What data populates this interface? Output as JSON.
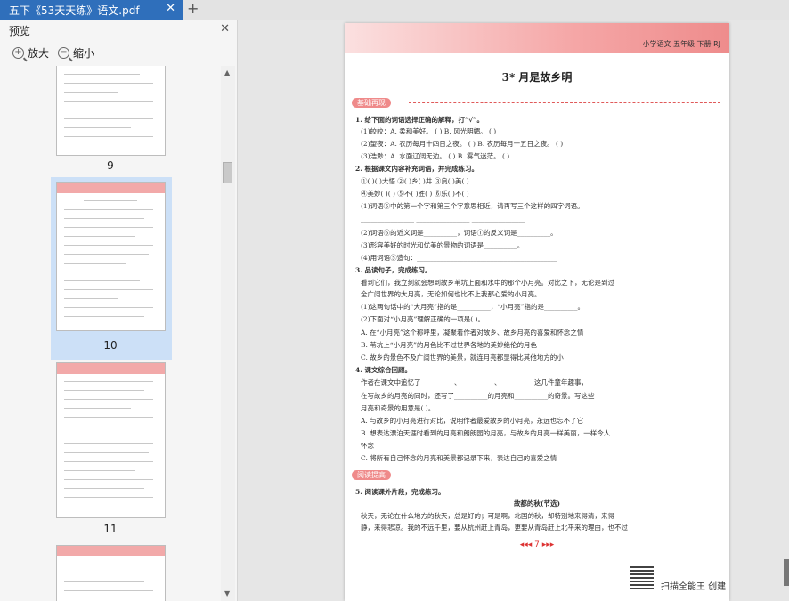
{
  "tab": {
    "title": "五下《53天天练》语文.pdf",
    "close": "✕",
    "add": "+"
  },
  "panel": {
    "title": "预览",
    "close": "✕",
    "zoom_in": "放大",
    "zoom_out": "缩小"
  },
  "thumbnails": [
    {
      "label": "9"
    },
    {
      "label": "10",
      "selected": true
    },
    {
      "label": "11"
    },
    {
      "label": ""
    }
  ],
  "page": {
    "header": "小学语文  五年级  下册  RJ",
    "title": "3*  月是故乡明",
    "section1": "基础再现",
    "section2": "阅读提高",
    "lines": [
      {
        "text": "1. 给下面的词语选择正确的解释，打“√”。",
        "bold": true
      },
      {
        "text": "(1)皎皎：A. 柔和美好。    (    )        B. 风光明媚。    (    )"
      },
      {
        "text": "(2)望夜：A. 农历每月十四日之夜。 (    )     B. 农历每月十五日之夜。 (    )"
      },
      {
        "text": "(3)浩渺：A. 水面辽阔无边。    (    )        B. 雾气迷茫。    (    )"
      },
      {
        "text": "2. 根据课文内容补充词语，并完成练习。",
        "bold": true
      },
      {
        "text": "①(    )(    )大悟      ②(    )乡(    )井      ③良(    )美(    )"
      },
      {
        "text": "④美妙(    )(    )      ⑤不(    )胜(    )      ⑥乐(    )不(    )"
      },
      {
        "text": "(1)词语⑤中的第一个字和第三个字意思相近，请再写三个这样的四字词语。"
      },
      {
        "text": "________________  ________________  ________________"
      },
      {
        "text": "(2)词语⑥的近义词是__________，词语①的反义词是__________。"
      },
      {
        "text": "(3)形容美好的时光和优美的景物的词语是__________。"
      },
      {
        "text": "(4)用词语⑤造句：__________________________________________"
      },
      {
        "text": "3. 品读句子，完成练习。",
        "bold": true
      },
      {
        "text": "    看到它们，我立刻就会想到故乡苇坑上面和水中的那个小月亮。对比之下，无论是到过"
      },
      {
        "text": "全广阔世界的大月亮，无论如何也比不上我那心爱的小月亮。"
      },
      {
        "text": "(1)这两句话中的“大月亮”指的是__________，“小月亮”指的是__________。"
      },
      {
        "text": "(2)下面对“小月亮”理解正确的一项是(    )。"
      },
      {
        "text": "    A. 在“小月亮”这个称呼里，凝聚着作者对故乡、故乡月亮的喜爱和怀念之情"
      },
      {
        "text": "    B. 苇坑上“小月亮”的月色比不过世界各地的美妙绝伦的月色"
      },
      {
        "text": "    C. 故乡的景色不及广阔世界的美景，就连月亮都显得比其他地方的小"
      },
      {
        "text": "4. 课文综合回顾。",
        "bold": true
      },
      {
        "text": "    作者在课文中追忆了__________、__________、__________这几件童年趣事，"
      },
      {
        "text": "在写故乡的月亮的同时，还写了__________的月亮和__________的奇景。写这些"
      },
      {
        "text": "月亮和奇景的用意是(    )。"
      },
      {
        "text": "A. 与故乡的小月亮进行对比，说明作者最爱故乡的小月亮，永远也忘不了它"
      },
      {
        "text": "B. 想表达漂泊天涯时看到的月亮和朗朗园的月亮，与故乡的月亮一样美丽，一样令人"
      },
      {
        "text": "   怀念"
      },
      {
        "text": "C. 将所有自己怀念的月亮和美景都记录下来，表达自己的喜爱之情"
      },
      {
        "text": "5. 阅读课外片段，完成练习。",
        "bold": true
      },
      {
        "text": "故都的秋(节选)",
        "bold": true,
        "center": true
      },
      {
        "text": "    秋天，无论在什么地方的秋天，总是好的；可是啊，北国的秋，却特别地来得清，来得"
      },
      {
        "text": "静，来得悲凉。我的不远千里，要从杭州赶上青岛，更要从青岛赶上北平来的理由，也不过"
      }
    ],
    "page_number": "◂◂◂  7  ▸▸▸",
    "scanner": "扫描全能王  创建"
  }
}
